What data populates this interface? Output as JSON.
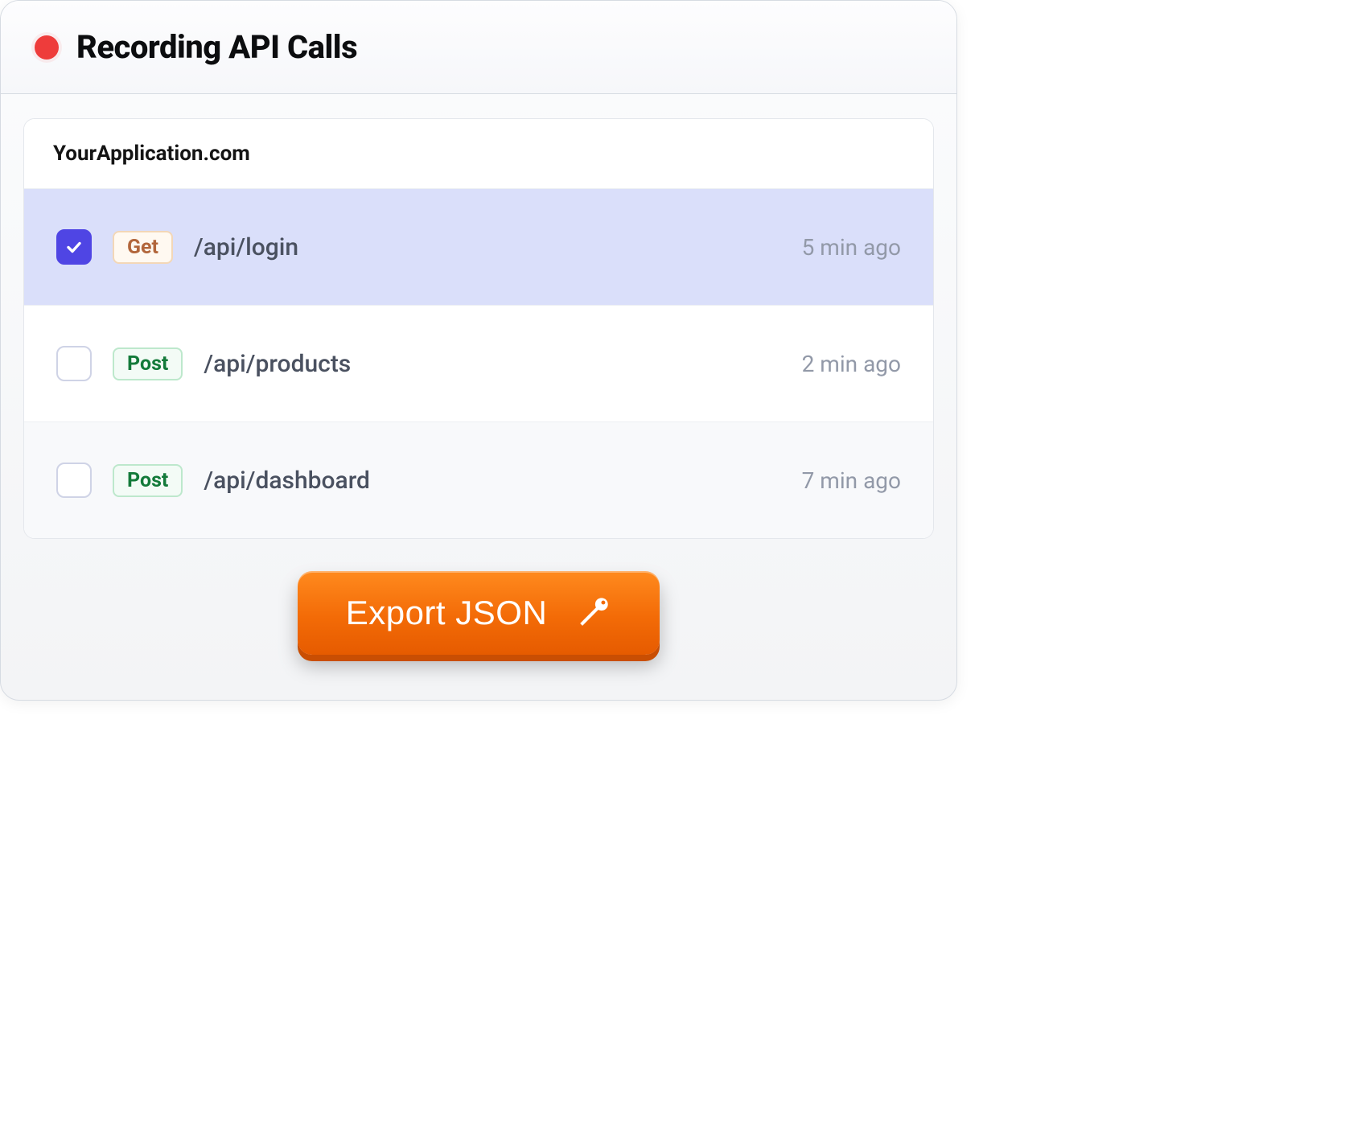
{
  "header": {
    "title": "Recording API Calls"
  },
  "domain": "YourApplication.com",
  "calls": [
    {
      "checked": true,
      "method": "Get",
      "method_kind": "get",
      "endpoint": "/api/login",
      "time": "5 min ago",
      "selected": true,
      "alt": false
    },
    {
      "checked": false,
      "method": "Post",
      "method_kind": "post",
      "endpoint": "/api/products",
      "time": "2 min ago",
      "selected": false,
      "alt": false
    },
    {
      "checked": false,
      "method": "Post",
      "method_kind": "post",
      "endpoint": "/api/dashboard",
      "time": "7 min ago",
      "selected": false,
      "alt": true
    }
  ],
  "export": {
    "label": "Export JSON"
  }
}
